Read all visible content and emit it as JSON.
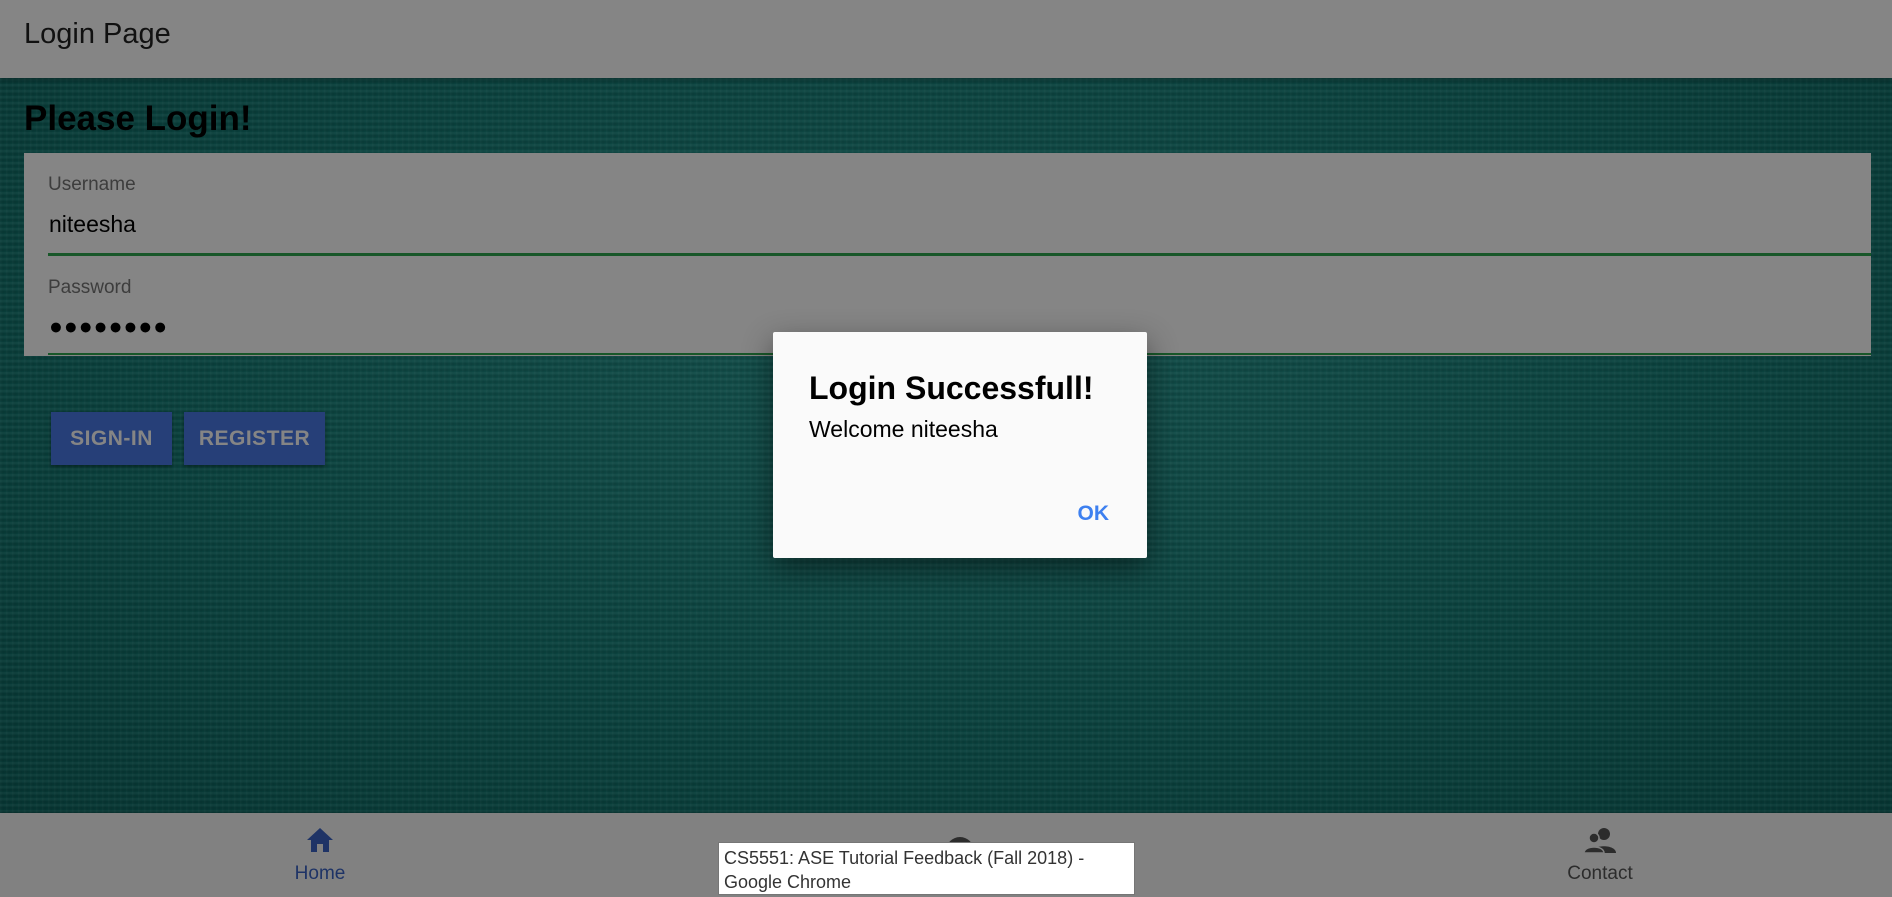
{
  "header": {
    "title": "Login Page"
  },
  "page": {
    "heading": "Please Login!"
  },
  "form": {
    "username": {
      "label": "Username",
      "value": "niteesha"
    },
    "password": {
      "label": "Password",
      "value": "●●●●●●●●"
    }
  },
  "buttons": {
    "signin": "SIGN-IN",
    "register": "REGISTER"
  },
  "bottom_nav": {
    "items": [
      {
        "label": "Home",
        "icon": "home-icon",
        "active": true
      },
      {
        "label": "",
        "icon": "info-icon",
        "active": false
      },
      {
        "label": "Contact",
        "icon": "contact-icon",
        "active": false
      }
    ]
  },
  "dialog": {
    "title": "Login Successfull!",
    "message": "Welcome niteesha",
    "ok_label": "OK"
  },
  "tooltip": {
    "text": "CS5551: ASE Tutorial Feedback (Fall 2018) - Google Chrome"
  },
  "colors": {
    "accent": "#4a79e6",
    "field_underline": "#2fa84f",
    "dialog_action": "#3d80f0",
    "nav_active": "#3a63c4"
  }
}
